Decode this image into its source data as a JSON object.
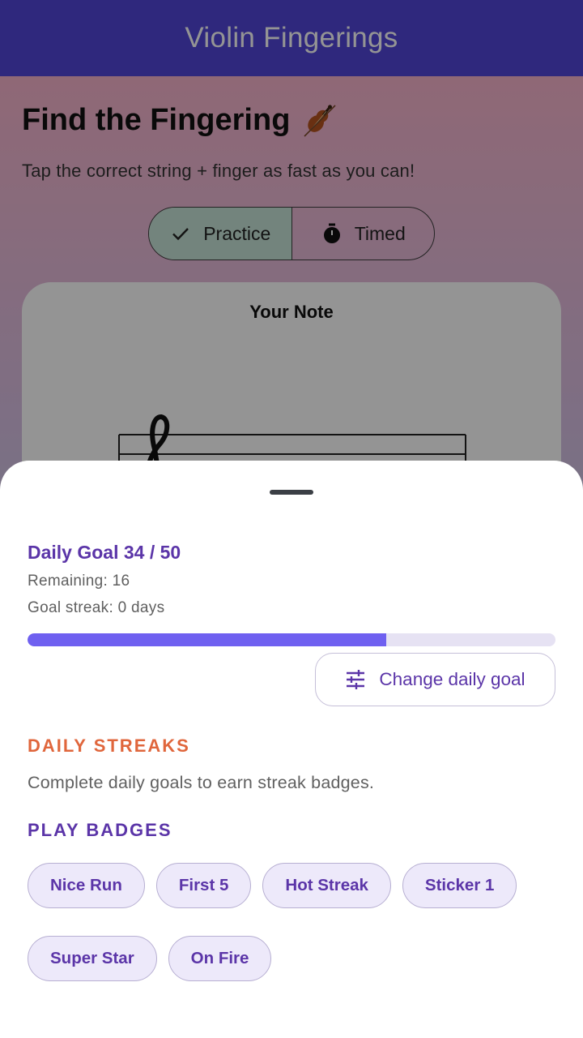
{
  "app_bar": {
    "title": "Violin Fingerings"
  },
  "screen": {
    "title": "Find the Fingering",
    "title_icon": "violin-icon",
    "subtitle": "Tap the correct string + finger as fast as you can!",
    "mode_toggle": {
      "options": [
        {
          "label": "Practice",
          "icon": "check-icon",
          "selected": true
        },
        {
          "label": "Timed",
          "icon": "timer-icon",
          "selected": false
        }
      ]
    },
    "note_card": {
      "title": "Your Note"
    }
  },
  "sheet": {
    "goal_title": "Daily Goal 34 / 50",
    "goal_progress": 0.68,
    "remaining": "Remaining: 16",
    "streak": "Goal streak: 0 days",
    "change_goal_label": "Change daily goal",
    "daily_streaks_heading": "DAILY STREAKS",
    "daily_streaks_desc": "Complete daily goals to earn streak badges.",
    "play_badges_heading": "PLAY BADGES",
    "badges": [
      "Nice Run",
      "First 5",
      "Hot Streak",
      "Sticker 1",
      "Super Star",
      "On Fire"
    ]
  },
  "colors": {
    "app_bar": "#5146d8",
    "accent": "#5b35a8",
    "progress": "#6f60f0",
    "streak_heading": "#e0663c"
  }
}
